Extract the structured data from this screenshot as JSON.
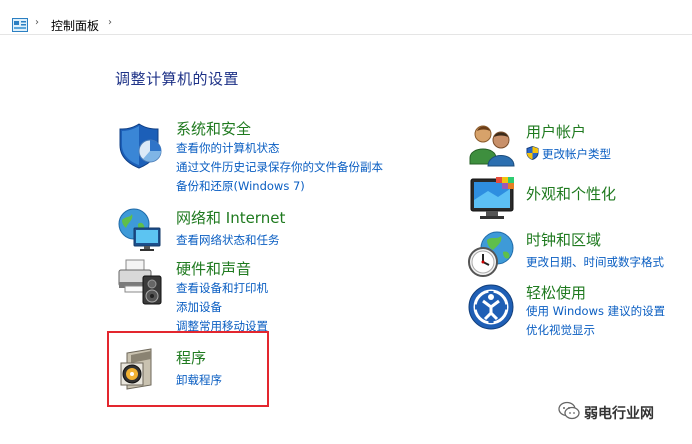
{
  "address_bar": {
    "separator": "›",
    "path": "控制面板"
  },
  "page_title": "调整计算机的设置",
  "left_categories": [
    {
      "title": "系统和安全",
      "icon": "shield-pie-icon",
      "links": [
        "查看你的计算机状态",
        "通过文件历史记录保存你的文件备份副本",
        "备份和还原(Windows 7)"
      ]
    },
    {
      "title": "网络和 Internet",
      "icon": "globe-network-icon",
      "links": [
        "查看网络状态和任务"
      ]
    },
    {
      "title": "硬件和声音",
      "icon": "printer-speaker-icon",
      "links": [
        "查看设备和打印机",
        "添加设备",
        "调整常用移动设置"
      ]
    },
    {
      "title": "程序",
      "icon": "program-disc-icon",
      "links": [
        "卸载程序"
      ]
    }
  ],
  "right_categories": [
    {
      "title": "用户帐户",
      "icon": "users-icon",
      "links": [
        "更改帐户类型"
      ]
    },
    {
      "title": "外观和个性化",
      "icon": "monitor-colors-icon",
      "links": []
    },
    {
      "title": "时钟和区域",
      "icon": "clock-globe-icon",
      "links": [
        "更改日期、时间或数字格式"
      ]
    },
    {
      "title": "轻松使用",
      "icon": "ease-of-access-icon",
      "links": [
        "使用 Windows 建议的设置",
        "优化视觉显示"
      ]
    }
  ],
  "watermark": {
    "text": "弱电行业网",
    "icon": "wechat-icon"
  },
  "colors": {
    "category_title": "#1f7a1f",
    "link": "#0a5ec2",
    "page_title": "#1e3287",
    "highlight_border": "#e3262e"
  }
}
